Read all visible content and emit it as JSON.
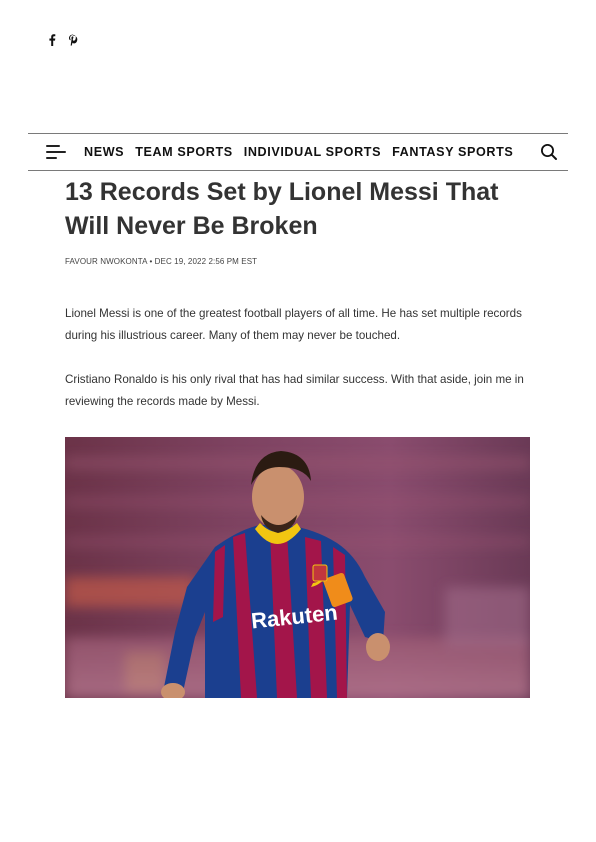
{
  "social": {
    "icons": [
      "facebook-icon",
      "pinterest-icon"
    ]
  },
  "nav": {
    "menu_icon": "hamburger-icon",
    "items": [
      "NEWS",
      "TEAM SPORTS",
      "INDIVIDUAL SPORTS",
      "FANTASY SPORTS"
    ],
    "search_icon": "search-icon"
  },
  "article": {
    "title": "13 Records Set by Lionel Messi That Will Never Be Broken",
    "author": "FAVOUR NWOKONTA",
    "separator": "•",
    "date": "DEC 19, 2022 2:56 PM EST",
    "paragraphs": [
      "Lionel Messi is one of the greatest football players of all time. He has set multiple records during his illustrious career. Many of them may never be touched.",
      "Cristiano Ronaldo is his only rival that has had similar success. With that aside, join me in reviewing the records made by Messi."
    ],
    "hero_image": {
      "shirt_sponsor": "Rakuten"
    }
  },
  "colors": {
    "text": "#333333",
    "nav_text": "#111111",
    "border": "#7a7a7a",
    "shirt_blue": "#1b3f8f",
    "shirt_red": "#a3154a",
    "collar_yellow": "#f2c511"
  }
}
